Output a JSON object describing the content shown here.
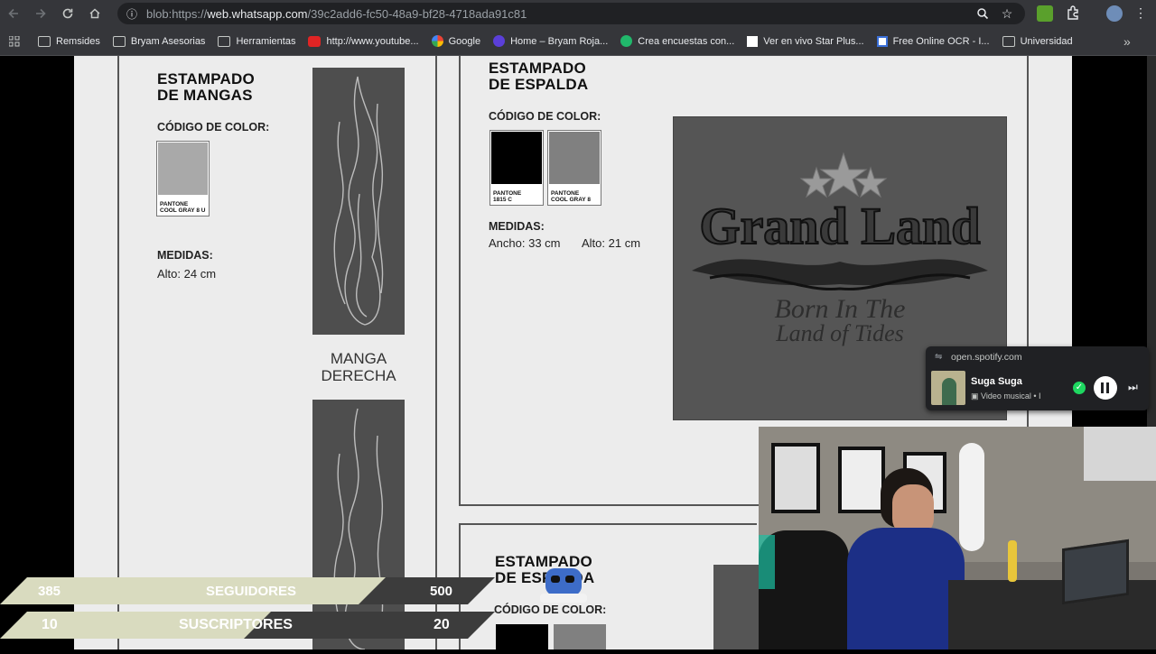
{
  "browser": {
    "url_scheme": "blob:https://",
    "url_host": "web.whatsapp.com",
    "url_path": "/39c2add6-fc50-48a9-bf28-4718ada91c81"
  },
  "bookmarks": [
    {
      "label": "Remsides",
      "icon": "folder-icon"
    },
    {
      "label": "Bryam Asesorias",
      "icon": "folder-icon"
    },
    {
      "label": "Herramientas",
      "icon": "folder-icon"
    },
    {
      "label": "http://www.youtube...",
      "icon": "youtube-icon"
    },
    {
      "label": "Google",
      "icon": "google-icon"
    },
    {
      "label": "Home – Bryam Roja...",
      "icon": "site-icon"
    },
    {
      "label": "Crea encuestas con...",
      "icon": "survey-icon"
    },
    {
      "label": "Ver en vivo Star Plus...",
      "icon": "page-icon"
    },
    {
      "label": "Free Online OCR - I...",
      "icon": "ocr-icon"
    },
    {
      "label": "Universidad",
      "icon": "folder-icon"
    }
  ],
  "document": {
    "sleeves": {
      "title_line1": "ESTAMPADO",
      "title_line2": "DE MANGAS",
      "color_label": "CÓDIGO DE COLOR:",
      "swatch": {
        "text_line1": "PANTONE",
        "text_line2": "COOL GRAY 8 U",
        "color": "#a9a9a9"
      },
      "measures_label": "MEDIDAS:",
      "height": "Alto: 24 cm",
      "right_sleeve_label_1": "MANGA",
      "right_sleeve_label_2": "DERECHA"
    },
    "back": {
      "title_line1": "ESTAMPADO",
      "title_line2": "DE ESPALDA",
      "color_label": "CÓDIGO DE COLOR:",
      "swatches": [
        {
          "text_line1": "PANTONE",
          "text_line2": "1815 C",
          "color": "#000000"
        },
        {
          "text_line1": "PANTONE",
          "text_line2": "COOL GRAY 8",
          "color": "#808080"
        }
      ],
      "measures_label": "MEDIDAS:",
      "width": "Ancho: 33 cm",
      "height": "Alto: 21 cm",
      "design_line1": "Grand Land",
      "design_line2": "Born In The",
      "design_line3": "Land of Tides"
    },
    "third": {
      "title_line1": "ESTAMPADO",
      "title_line2": "DE ESPALDA",
      "color_label": "CÓDIGO DE COLOR:"
    }
  },
  "spotify": {
    "source": "open.spotify.com",
    "track": "Suga Suga",
    "subtitle": "Video musical • I"
  },
  "stream": {
    "followers_current": "385",
    "followers_label": "SEGUIDORES",
    "followers_goal": "500",
    "subs_current": "10",
    "subs_label": "SUSCRIPTORES",
    "subs_goal": "20",
    "bar_color": "#d9dbbf",
    "dark_color": "#3c3c3c"
  }
}
